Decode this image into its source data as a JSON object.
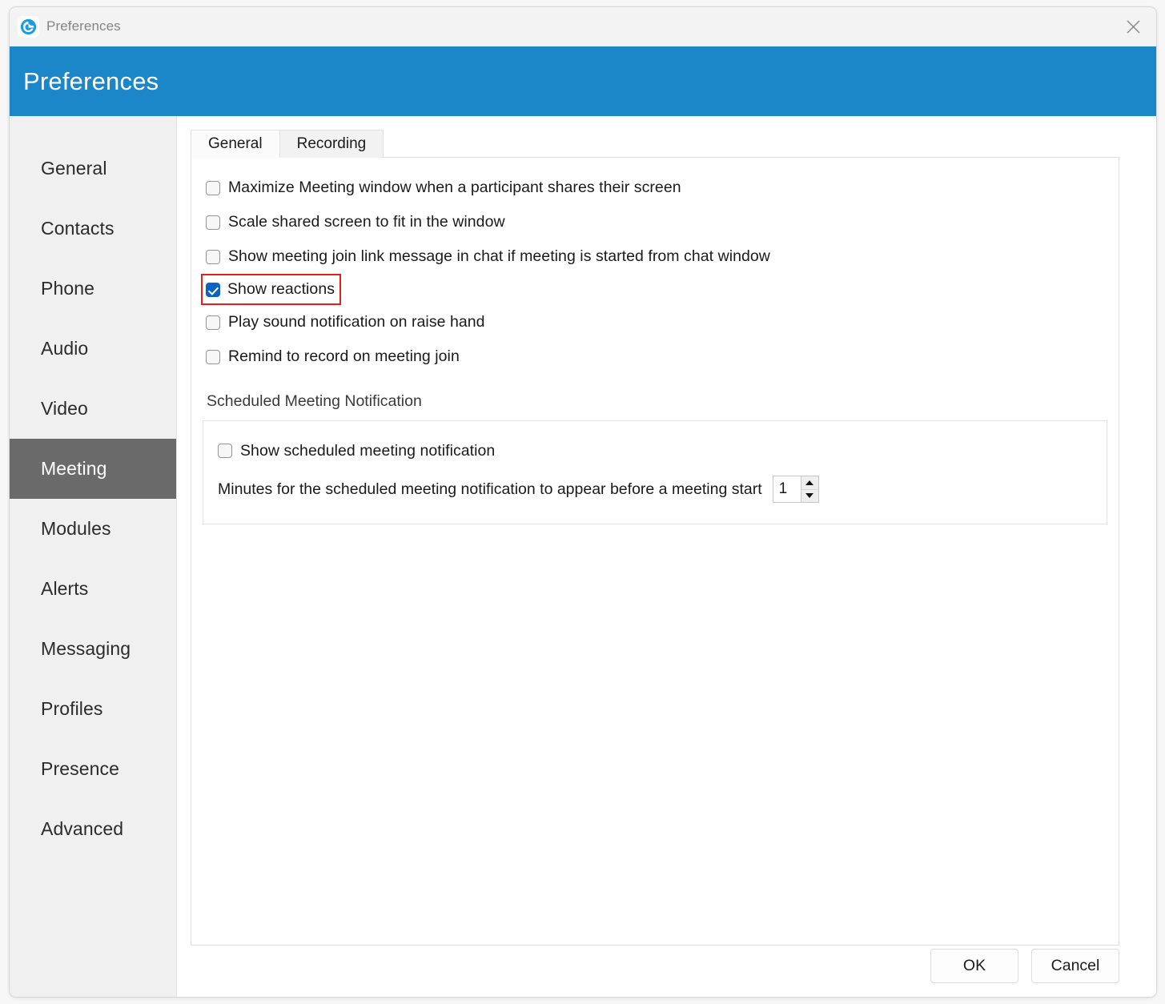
{
  "window": {
    "titlebar_title": "Preferences",
    "close_label": "×",
    "header_title": "Preferences"
  },
  "colors": {
    "header_blue": "#1b86c8",
    "sidebar_selected": "#6a6a6a",
    "checkbox_checked": "#0a62c2",
    "highlight_outline": "#e0201b"
  },
  "sidebar": {
    "items": [
      {
        "label": "General",
        "selected": false
      },
      {
        "label": "Contacts",
        "selected": false
      },
      {
        "label": "Phone",
        "selected": false
      },
      {
        "label": "Audio",
        "selected": false
      },
      {
        "label": "Video",
        "selected": false
      },
      {
        "label": "Meeting",
        "selected": true
      },
      {
        "label": "Modules",
        "selected": false
      },
      {
        "label": "Alerts",
        "selected": false
      },
      {
        "label": "Messaging",
        "selected": false
      },
      {
        "label": "Profiles",
        "selected": false
      },
      {
        "label": "Presence",
        "selected": false
      },
      {
        "label": "Advanced",
        "selected": false
      }
    ]
  },
  "tabs": [
    {
      "label": "General",
      "active": true
    },
    {
      "label": "Recording",
      "active": false
    }
  ],
  "options": [
    {
      "label": "Maximize Meeting window when a participant shares their screen",
      "checked": false,
      "highlighted": false
    },
    {
      "label": "Scale shared screen to fit in the window",
      "checked": false,
      "highlighted": false
    },
    {
      "label": "Show meeting join link message in chat if meeting is started from chat window",
      "checked": false,
      "highlighted": false
    },
    {
      "label": "Show reactions",
      "checked": true,
      "highlighted": true
    },
    {
      "label": "Play sound notification on raise hand",
      "checked": false,
      "highlighted": false
    },
    {
      "label": "Remind to record on meeting join",
      "checked": false,
      "highlighted": false
    }
  ],
  "section": {
    "title": "Scheduled Meeting Notification",
    "checkbox_label": "Show scheduled meeting notification",
    "checkbox_checked": false,
    "minutes_label": "Minutes for the scheduled meeting notification to appear before a meeting start",
    "minutes_value": "1"
  },
  "footer": {
    "ok_label": "OK",
    "cancel_label": "Cancel"
  }
}
